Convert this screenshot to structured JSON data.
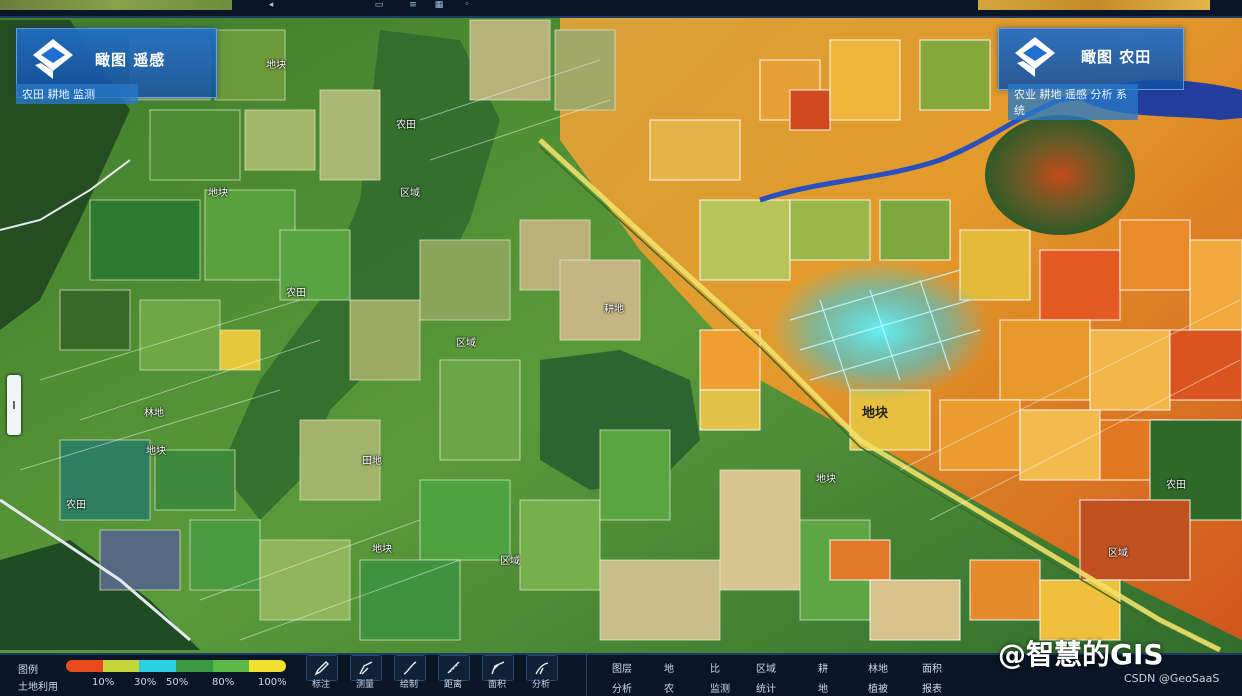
{
  "top_panel": {
    "title": "瞰图 遥感",
    "subtitle": "农田 耕地 监测"
  },
  "top_panel_right": {
    "title": "瞰图 农田",
    "subtitle": "农业 耕地 遥感 分析 系统"
  },
  "map_labels": [
    {
      "text": "地块"
    },
    {
      "text": "农田"
    },
    {
      "text": "地块"
    },
    {
      "text": "区域"
    },
    {
      "text": "农田"
    },
    {
      "text": "区域"
    },
    {
      "text": "林地"
    },
    {
      "text": "地块"
    },
    {
      "text": "田地"
    },
    {
      "text": "农田"
    },
    {
      "text": "地块"
    },
    {
      "text": "区域"
    },
    {
      "text": "耕地"
    },
    {
      "text": "农田"
    },
    {
      "text": "区域"
    },
    {
      "text": "地块"
    }
  ],
  "highlight_label": "地块",
  "legend": {
    "label_top": "图例",
    "label_bottom": "土地利用",
    "ramp_colors": [
      "#e84a1c",
      "#c8d63a",
      "#2ad0e0",
      "#3a9a44",
      "#5ab845",
      "#f0e030"
    ],
    "ticks": [
      "10%",
      "30%",
      "50%",
      "80%",
      "100%"
    ]
  },
  "tools": [
    {
      "icon": "pen-icon",
      "label": "标注"
    },
    {
      "icon": "pen-icon",
      "label": "测量"
    },
    {
      "icon": "pen-icon",
      "label": "绘制"
    },
    {
      "icon": "ruler-icon",
      "label": "距离"
    },
    {
      "icon": "pen-icon",
      "label": "面积"
    },
    {
      "icon": "pen-icon",
      "label": "分析"
    }
  ],
  "right_panel": {
    "row1": [
      "图层",
      "地",
      "比",
      "区域",
      "耕",
      "林地",
      "面积"
    ],
    "row2": [
      "分析",
      "农",
      "监测",
      "统计",
      "地",
      "植被",
      "报表"
    ]
  },
  "watermark": "@智慧的GIS",
  "credit": "CSDN @GeoSaaS",
  "colors": {
    "accent": "#1f6fd0",
    "panel_bg": "#0a1626"
  }
}
